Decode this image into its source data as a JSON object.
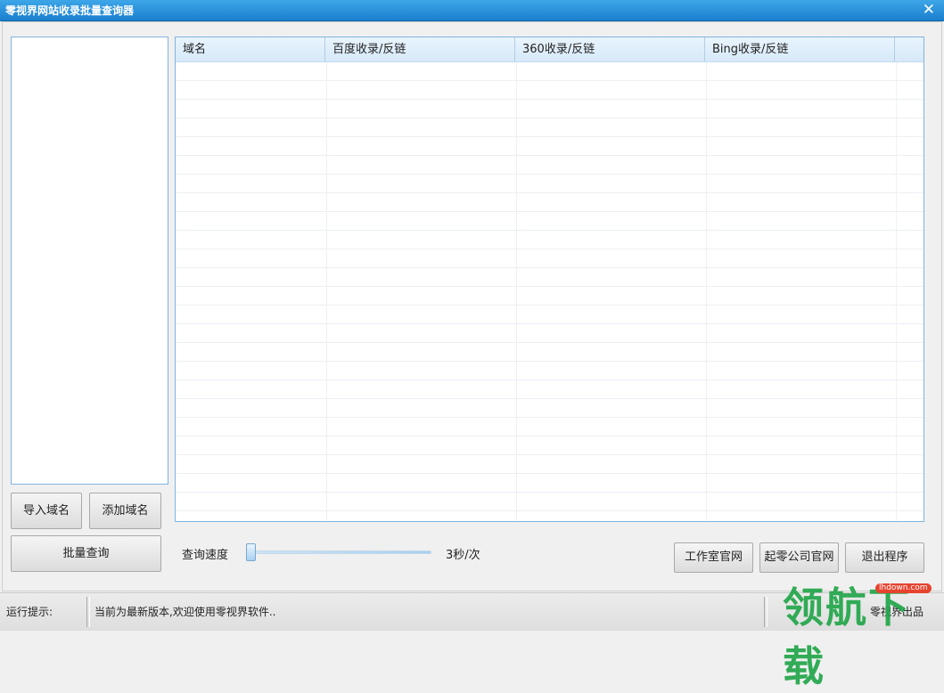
{
  "window": {
    "title": "零视界网站收录批量查询器",
    "close_icon": "close-icon"
  },
  "grid": {
    "columns": [
      "域名",
      "百度收录/反链",
      "360收录/反链",
      "Bing收录/反链"
    ]
  },
  "left_buttons": {
    "import": "导入域名",
    "add": "添加域名",
    "batch_query": "批量查询"
  },
  "speed": {
    "label": "查询速度",
    "value": "3秒/次",
    "slider_level": 0
  },
  "right_buttons": {
    "studio_site": "工作室官网",
    "company_site": "起零公司官网",
    "exit": "退出程序"
  },
  "status": {
    "label": "运行提示:",
    "message": "当前为最新版本,欢迎使用零视界软件..",
    "right": "零视界出品"
  },
  "watermark": {
    "text": "领航下载",
    "badge": "lhdown.com"
  }
}
